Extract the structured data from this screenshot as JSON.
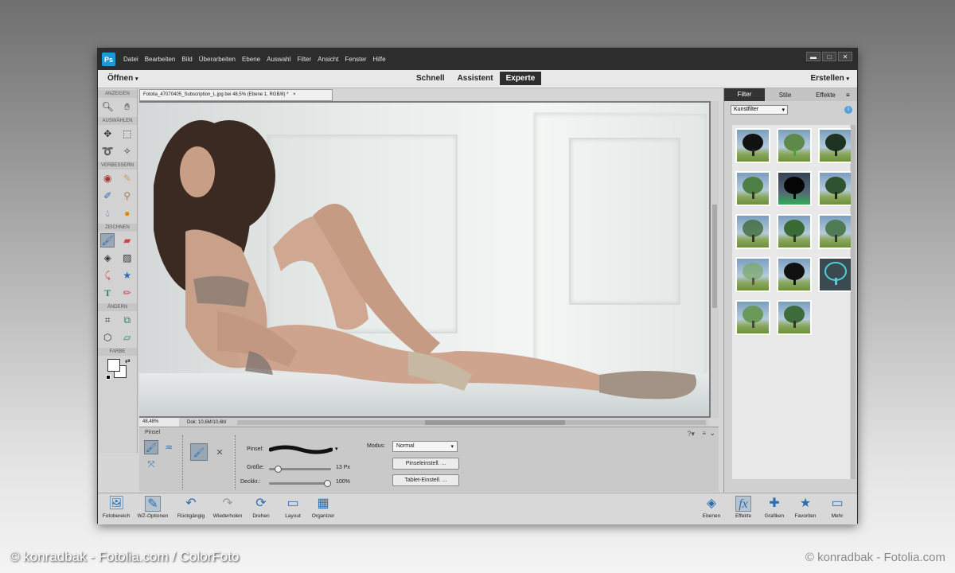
{
  "menubar": {
    "logo": "Ps",
    "items": [
      "Datei",
      "Bearbeiten",
      "Bild",
      "Überarbeiten",
      "Ebene",
      "Auswahl",
      "Filter",
      "Ansicht",
      "Fenster",
      "Hilfe"
    ],
    "controls": [
      "▬",
      "□",
      "✕"
    ]
  },
  "modebar": {
    "open_label": "Öffnen",
    "modes": [
      "Schnell",
      "Assistent",
      "Experte"
    ],
    "active_mode": "Experte",
    "create_label": "Erstellen"
  },
  "toolbox": {
    "sections": [
      "ANZEIGEN",
      "AUSWÄHLEN",
      "VERBESSERN",
      "ZEICHNEN",
      "ÄNDERN",
      "FARBE"
    ]
  },
  "document": {
    "tab_title": "Fotolia_47070405_Subscription_L.jpg bei 48,5% (Ebene 1, RGB/8) *",
    "close": "×",
    "zoom": "48,48%",
    "doc_size": "Dok: 10,6M/10,6M"
  },
  "options": {
    "tool_name": "Pinsel",
    "brush_label": "Pinsel:",
    "size_label": "Größe:",
    "size_value": "13 Px",
    "size_fraction": 0.1,
    "opacity_label": "Deckkr.:",
    "opacity_value": "100%",
    "opacity_fraction": 1.0,
    "mode_label": "Modus:",
    "mode_value": "Normal",
    "brush_settings_btn": "Pinseleinstell. ...",
    "tablet_settings_btn": "Tablet-Einstell. ..."
  },
  "right_panel": {
    "tabs": [
      "Filter",
      "Stile",
      "Effekte"
    ],
    "active_tab": "Filter",
    "filter_category": "Kunstfilter"
  },
  "taskbar": {
    "left": [
      "Fotobereich",
      "WZ-Optionen",
      "Rückgängig",
      "Wiederholen",
      "Drehen",
      "Layout",
      "Organizer"
    ],
    "right": [
      "Ebenen",
      "Effekte",
      "Grafiken",
      "Favoriten",
      "Mehr"
    ]
  },
  "credits": {
    "left": "© konradbak - Fotolia.com / ColorFoto",
    "right": "© konradbak - Fotolia.com"
  },
  "colors": {
    "accent": "#1a9ad6",
    "menubar_bg": "#2d2d2d",
    "icon_blue": "#2a6db0"
  }
}
